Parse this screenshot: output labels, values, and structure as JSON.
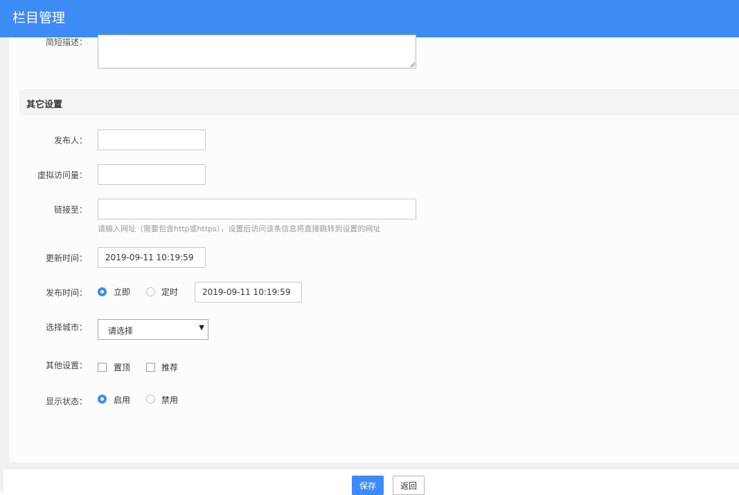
{
  "header": {
    "title": "栏目管理"
  },
  "form": {
    "partial_label": "简短描述：",
    "section_title": "其它设置",
    "publisher": {
      "label": "发布人：",
      "value": ""
    },
    "virtual_views": {
      "label": "虚拟访问量：",
      "value": ""
    },
    "link_to": {
      "label": "链接至：",
      "value": "",
      "hint": "请输入网址（需要包含http或https），设置后访问该条信息将直接跳转到设置的网址"
    },
    "update_time": {
      "label": "更新时间：",
      "value": "2019-09-11 10:19:59"
    },
    "publish_time": {
      "label": "发布时间：",
      "options": [
        "立即",
        "定时"
      ],
      "selected": "立即",
      "scheduled_value": "2019-09-11 10:19:59"
    },
    "city": {
      "label": "选择城市：",
      "selected": "请选择"
    },
    "other": {
      "label": "其他设置：",
      "options": [
        "置顶",
        "推荐"
      ]
    },
    "status": {
      "label": "显示状态：",
      "options": [
        "启用",
        "禁用"
      ],
      "selected": "启用"
    }
  },
  "footer": {
    "save_label": "保存",
    "back_label": "返回"
  },
  "colors": {
    "accent": "#3d8bf5",
    "header_bg": "#3d8bf5"
  },
  "icons": {
    "select_arrow": "caret-down-icon",
    "textarea_resize": "resize-grip-icon"
  }
}
